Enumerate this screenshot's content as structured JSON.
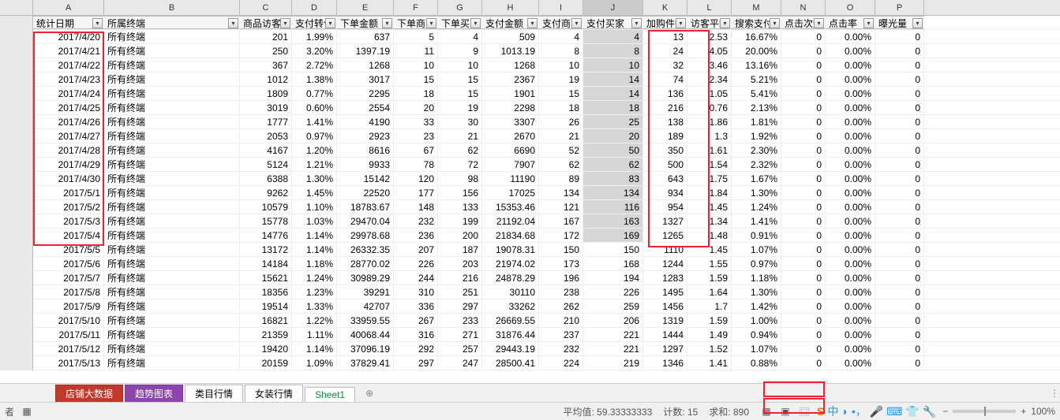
{
  "columns": [
    "A",
    "B",
    "C",
    "D",
    "E",
    "F",
    "G",
    "H",
    "I",
    "J",
    "K",
    "L",
    "M",
    "N",
    "O",
    "P"
  ],
  "headers": [
    "统计日期",
    "所属终端",
    "商品访客",
    "支付转化",
    "下单金额",
    "下单商品",
    "下单买家",
    "支付金额",
    "支付商品",
    "支付买家",
    "加购件数",
    "访客平均",
    "搜索支付",
    "点击次数",
    "点击率",
    "曝光量"
  ],
  "rows": [
    [
      "2017/4/20",
      "所有终端",
      "201",
      "1.99%",
      "637",
      "5",
      "4",
      "509",
      "4",
      "4",
      "13",
      "2.53",
      "16.67%",
      "0",
      "0.00%",
      "0"
    ],
    [
      "2017/4/21",
      "所有终端",
      "250",
      "3.20%",
      "1397.19",
      "11",
      "9",
      "1013.19",
      "8",
      "8",
      "24",
      "4.05",
      "20.00%",
      "0",
      "0.00%",
      "0"
    ],
    [
      "2017/4/22",
      "所有终端",
      "367",
      "2.72%",
      "1268",
      "10",
      "10",
      "1268",
      "10",
      "10",
      "32",
      "3.46",
      "13.16%",
      "0",
      "0.00%",
      "0"
    ],
    [
      "2017/4/23",
      "所有终端",
      "1012",
      "1.38%",
      "3017",
      "15",
      "15",
      "2367",
      "19",
      "14",
      "74",
      "2.34",
      "5.21%",
      "0",
      "0.00%",
      "0"
    ],
    [
      "2017/4/24",
      "所有终端",
      "1809",
      "0.77%",
      "2295",
      "18",
      "15",
      "1901",
      "15",
      "14",
      "136",
      "1.05",
      "5.41%",
      "0",
      "0.00%",
      "0"
    ],
    [
      "2017/4/25",
      "所有终端",
      "3019",
      "0.60%",
      "2554",
      "20",
      "19",
      "2298",
      "18",
      "18",
      "216",
      "0.76",
      "2.13%",
      "0",
      "0.00%",
      "0"
    ],
    [
      "2017/4/26",
      "所有终端",
      "1777",
      "1.41%",
      "4190",
      "33",
      "30",
      "3307",
      "26",
      "25",
      "138",
      "1.86",
      "1.81%",
      "0",
      "0.00%",
      "0"
    ],
    [
      "2017/4/27",
      "所有终端",
      "2053",
      "0.97%",
      "2923",
      "23",
      "21",
      "2670",
      "21",
      "20",
      "189",
      "1.3",
      "1.92%",
      "0",
      "0.00%",
      "0"
    ],
    [
      "2017/4/28",
      "所有终端",
      "4167",
      "1.20%",
      "8616",
      "67",
      "62",
      "6690",
      "52",
      "50",
      "350",
      "1.61",
      "2.30%",
      "0",
      "0.00%",
      "0"
    ],
    [
      "2017/4/29",
      "所有终端",
      "5124",
      "1.21%",
      "9933",
      "78",
      "72",
      "7907",
      "62",
      "62",
      "500",
      "1.54",
      "2.32%",
      "0",
      "0.00%",
      "0"
    ],
    [
      "2017/4/30",
      "所有终端",
      "6388",
      "1.30%",
      "15142",
      "120",
      "98",
      "11190",
      "89",
      "83",
      "643",
      "1.75",
      "1.67%",
      "0",
      "0.00%",
      "0"
    ],
    [
      "2017/5/1",
      "所有终端",
      "9262",
      "1.45%",
      "22520",
      "177",
      "156",
      "17025",
      "134",
      "134",
      "934",
      "1.84",
      "1.30%",
      "0",
      "0.00%",
      "0"
    ],
    [
      "2017/5/2",
      "所有终端",
      "10579",
      "1.10%",
      "18783.67",
      "148",
      "133",
      "15353.46",
      "121",
      "116",
      "954",
      "1.45",
      "1.24%",
      "0",
      "0.00%",
      "0"
    ],
    [
      "2017/5/3",
      "所有终端",
      "15778",
      "1.03%",
      "29470.04",
      "232",
      "199",
      "21192.04",
      "167",
      "163",
      "1327",
      "1.34",
      "1.41%",
      "0",
      "0.00%",
      "0"
    ],
    [
      "2017/5/4",
      "所有终端",
      "14776",
      "1.14%",
      "29978.68",
      "236",
      "200",
      "21834.68",
      "172",
      "169",
      "1265",
      "1.48",
      "0.91%",
      "0",
      "0.00%",
      "0"
    ],
    [
      "2017/5/5",
      "所有终端",
      "13172",
      "1.14%",
      "26332.35",
      "207",
      "187",
      "19078.31",
      "150",
      "150",
      "1110",
      "1.45",
      "1.07%",
      "0",
      "0.00%",
      "0"
    ],
    [
      "2017/5/6",
      "所有终端",
      "14184",
      "1.18%",
      "28770.02",
      "226",
      "203",
      "21974.02",
      "173",
      "168",
      "1244",
      "1.55",
      "0.97%",
      "0",
      "0.00%",
      "0"
    ],
    [
      "2017/5/7",
      "所有终端",
      "15621",
      "1.24%",
      "30989.29",
      "244",
      "216",
      "24878.29",
      "196",
      "194",
      "1283",
      "1.59",
      "1.18%",
      "0",
      "0.00%",
      "0"
    ],
    [
      "2017/5/8",
      "所有终端",
      "18356",
      "1.23%",
      "39291",
      "310",
      "251",
      "30110",
      "238",
      "226",
      "1495",
      "1.64",
      "1.30%",
      "0",
      "0.00%",
      "0"
    ],
    [
      "2017/5/9",
      "所有终端",
      "19514",
      "1.33%",
      "42707",
      "336",
      "297",
      "33262",
      "262",
      "259",
      "1456",
      "1.7",
      "1.42%",
      "0",
      "0.00%",
      "0"
    ],
    [
      "2017/5/10",
      "所有终端",
      "16821",
      "1.22%",
      "33959.55",
      "267",
      "233",
      "26669.55",
      "210",
      "206",
      "1319",
      "1.59",
      "1.00%",
      "0",
      "0.00%",
      "0"
    ],
    [
      "2017/5/11",
      "所有终端",
      "21359",
      "1.11%",
      "40068.44",
      "316",
      "271",
      "31876.44",
      "237",
      "221",
      "1444",
      "1.49",
      "0.94%",
      "0",
      "0.00%",
      "0"
    ],
    [
      "2017/5/12",
      "所有终端",
      "19420",
      "1.14%",
      "37096.19",
      "292",
      "257",
      "29443.19",
      "232",
      "221",
      "1297",
      "1.52",
      "1.07%",
      "0",
      "0.00%",
      "0"
    ],
    [
      "2017/5/13",
      "所有终端",
      "20159",
      "1.09%",
      "37829.41",
      "297",
      "247",
      "28500.41",
      "224",
      "219",
      "1346",
      "1.41",
      "0.88%",
      "0",
      "0.00%",
      "0"
    ]
  ],
  "selectedCol": 9,
  "highlightRows": 15,
  "tabs": [
    "店铺大数据",
    "趋势图表",
    "类目行情",
    "女装行情",
    "Sheet1"
  ],
  "activeTab": 4,
  "status": {
    "labelLeft": "者",
    "avgLabel": "平均值:",
    "avg": "59.33333333",
    "countLabel": "计数:",
    "count": "15",
    "sumLabel": "求和:",
    "sum": "890",
    "zoom": "100%"
  }
}
